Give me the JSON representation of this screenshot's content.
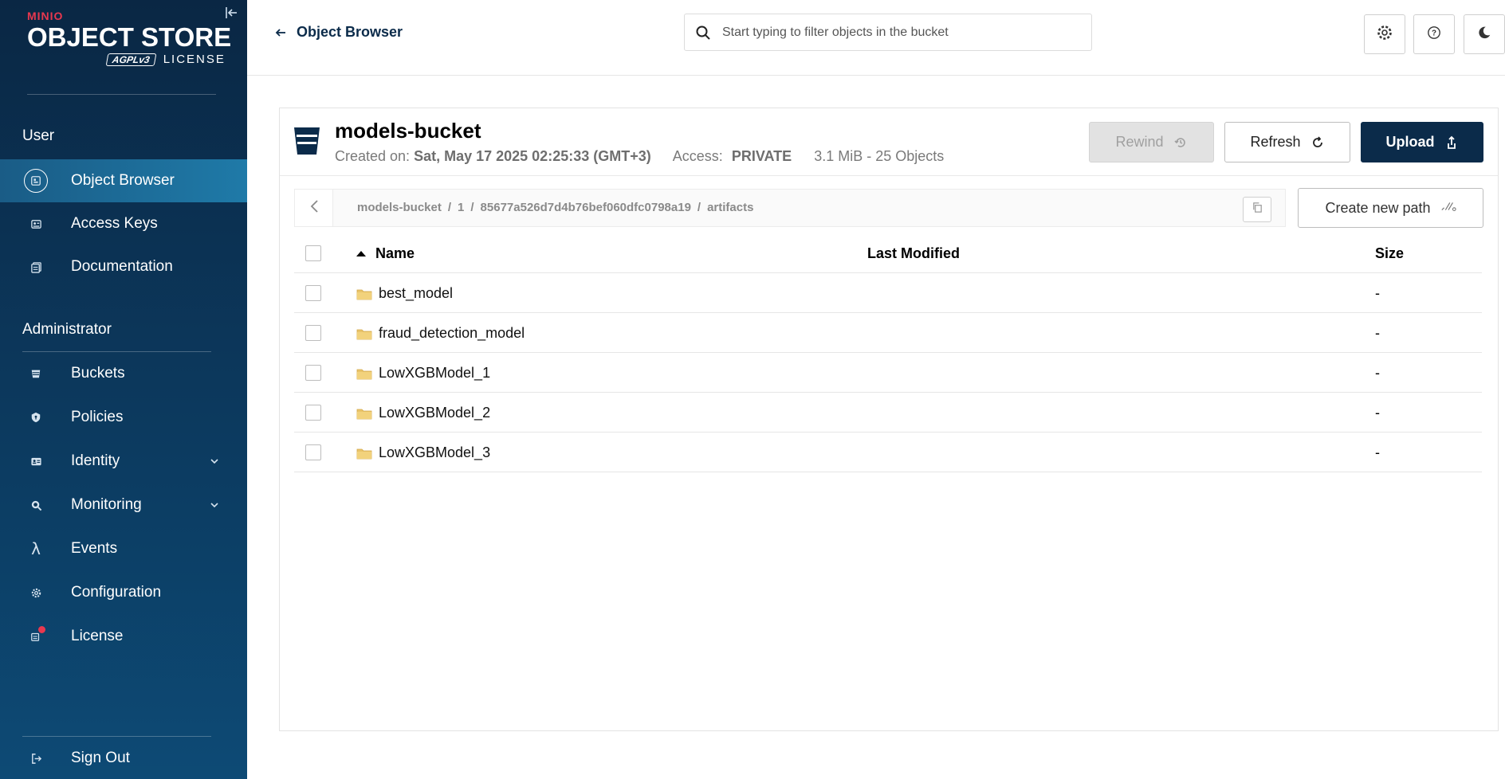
{
  "app": {
    "brand": "MINIO",
    "product": "OBJECT STORE",
    "agpl": "AGPLv3",
    "license_word": "LICENSE"
  },
  "sidebar": {
    "user_section": "User",
    "user_items": [
      {
        "label": "Object Browser",
        "icon": "object-browser-icon",
        "active": true
      },
      {
        "label": "Access Keys",
        "icon": "access-keys-icon"
      },
      {
        "label": "Documentation",
        "icon": "documentation-icon"
      }
    ],
    "admin_section": "Administrator",
    "admin_items": [
      {
        "label": "Buckets",
        "icon": "buckets-icon"
      },
      {
        "label": "Policies",
        "icon": "policies-icon"
      },
      {
        "label": "Identity",
        "icon": "identity-icon",
        "expandable": true
      },
      {
        "label": "Monitoring",
        "icon": "monitoring-icon",
        "expandable": true
      },
      {
        "label": "Events",
        "icon": "lambda-icon"
      },
      {
        "label": "Configuration",
        "icon": "gear-icon"
      },
      {
        "label": "License",
        "icon": "license-icon",
        "badge": true
      }
    ],
    "sign_out": "Sign Out"
  },
  "topbar": {
    "back_label": "Object Browser",
    "search_placeholder": "Start typing to filter objects in the bucket",
    "icons": [
      "settings-icon",
      "help-icon",
      "dark-mode-icon"
    ]
  },
  "bucket": {
    "name": "models-bucket",
    "created_label": "Created on:",
    "created_value": "Sat, May 17 2025 02:25:33 (GMT+3)",
    "access_label": "Access:",
    "access_value": "PRIVATE",
    "usage": "3.1 MiB - 25 Objects"
  },
  "actions": {
    "rewind": "Rewind",
    "refresh": "Refresh",
    "upload": "Upload",
    "create_path": "Create new path"
  },
  "breadcrumb": {
    "segments": [
      "models-bucket",
      "1",
      "85677a526d7d4b76bef060dfc0798a19",
      "artifacts"
    ]
  },
  "table": {
    "columns": {
      "name": "Name",
      "modified": "Last Modified",
      "size": "Size"
    },
    "rows": [
      {
        "name": "best_model",
        "modified": "",
        "size": "-"
      },
      {
        "name": "fraud_detection_model",
        "modified": "",
        "size": "-"
      },
      {
        "name": "LowXGBModel_1",
        "modified": "",
        "size": "-"
      },
      {
        "name": "LowXGBModel_2",
        "modified": "",
        "size": "-"
      },
      {
        "name": "LowXGBModel_3",
        "modified": "",
        "size": "-"
      }
    ]
  },
  "colors": {
    "sidebar_dark": "#0a2744",
    "primary": "#0b2b4a",
    "accent_red": "#e8384f",
    "folder": "#e9c46a"
  }
}
